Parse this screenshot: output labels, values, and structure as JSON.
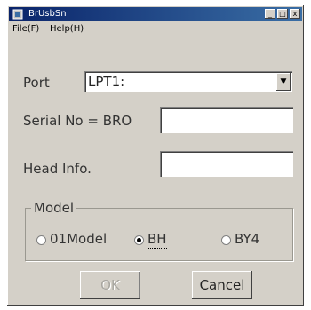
{
  "window": {
    "title": "BrUsbSn",
    "min_glyph": "_",
    "max_glyph": "□",
    "close_glyph": "x"
  },
  "menu": {
    "items": [
      "File(F)",
      "Help(H)"
    ]
  },
  "form": {
    "port_label": "Port",
    "port_value": "LPT1:",
    "serial_label": "Serial No = BRO",
    "serial_value": "",
    "head_label": "Head Info.",
    "head_value": ""
  },
  "model": {
    "legend": "Model",
    "options": [
      {
        "label": "01Model",
        "selected": false
      },
      {
        "label": "BH",
        "selected": true
      },
      {
        "label": "BY4",
        "selected": false
      }
    ]
  },
  "buttons": {
    "ok_label": "OK",
    "ok_enabled": false,
    "cancel_label": "Cancel"
  },
  "colors": {
    "face": "#d4d0c8",
    "title_start": "#0a246a",
    "title_end": "#3a6ea5"
  }
}
